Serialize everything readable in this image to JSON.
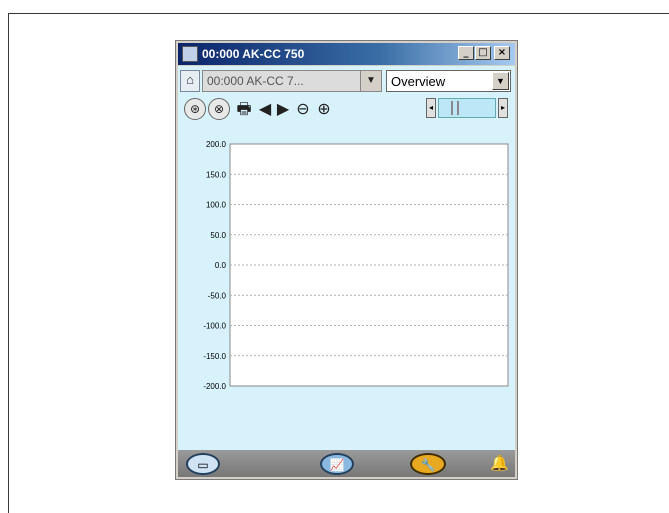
{
  "window": {
    "title": "00:000 AK-CC 750",
    "minimize_glyph": "_",
    "maximize_glyph": "□",
    "close_glyph": "×"
  },
  "toolbar": {
    "home_glyph": "⌂",
    "unit_select_value": "00:000 AK-CC 7...",
    "unit_select_arrow": "▼",
    "view_select_value": "Overview",
    "view_select_arrow": "▼"
  },
  "graph_toolbar": {
    "icons": [
      "zoom-fit-icon",
      "zoom-cycle-icon",
      "print-icon",
      "prev-icon",
      "next-icon",
      "zoom-out-icon",
      "zoom-in-icon"
    ],
    "glyphs": {
      "zoom_fit": "⊛",
      "zoom_cycle": "⊗",
      "print": "🖶",
      "prev": "◀",
      "next": "▶",
      "zoom_out": "⊖",
      "zoom_in": "⊕"
    }
  },
  "scroll": {
    "left_glyph": "◂",
    "right_glyph": "▸"
  },
  "chart_data": {
    "type": "line",
    "title": "",
    "xlabel": "",
    "ylabel": "",
    "ylim": [
      -200,
      200
    ],
    "y_ticks": [
      "200.0",
      "150.0",
      "100.0",
      "50.0",
      "0.0",
      "-50.0",
      "-100.0",
      "-150.0",
      "-200.0"
    ],
    "series": [],
    "grid": true,
    "gridline_color": "#b0b0b0",
    "plot_background": "#ffffff"
  },
  "bottom": {
    "icons": [
      "device-icon",
      "graph-icon",
      "wrench-icon",
      "alarm-bell-icon"
    ],
    "colors": {
      "graph_button": "#8ab8e0",
      "wrench_button": "#e8a820",
      "alarm": "#e0101a"
    }
  }
}
